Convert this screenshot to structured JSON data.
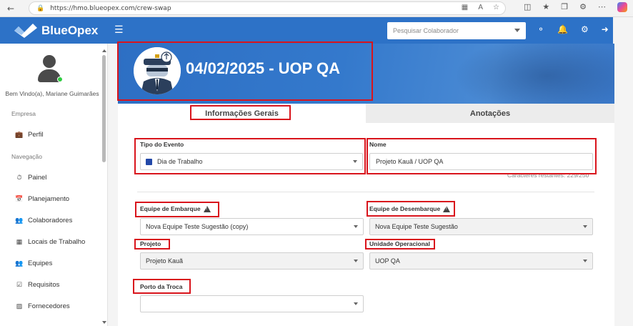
{
  "browser": {
    "url": "https://hmo.blueopex.com/crew-swap"
  },
  "header": {
    "brand": "BlueOpex",
    "search_placeholder": "Pesquisar Colaborador",
    "icons": [
      "support-icon",
      "bell-icon",
      "gear-icon",
      "logout-icon"
    ]
  },
  "sidebar": {
    "welcome": "Bem Vindo(a), Mariane Guimarães",
    "section_company": "Empresa",
    "section_nav": "Navegação",
    "items": [
      {
        "label": "Perfil",
        "icon": "briefcase-icon"
      },
      {
        "label": "Painel",
        "icon": "dashboard-icon"
      },
      {
        "label": "Planejamento",
        "icon": "calendar-icon"
      },
      {
        "label": "Colaboradores",
        "icon": "users-icon"
      },
      {
        "label": "Locais de Trabalho",
        "icon": "building-icon"
      },
      {
        "label": "Equipes",
        "icon": "team-icon"
      },
      {
        "label": "Requisitos",
        "icon": "checkbox-icon"
      },
      {
        "label": "Fornecedores",
        "icon": "truck-icon"
      }
    ]
  },
  "banner": {
    "title": "04/02/2025 - UOP QA"
  },
  "tabs": [
    {
      "label": "Informações Gerais",
      "active": true
    },
    {
      "label": "Anotações",
      "active": false
    }
  ],
  "form": {
    "tipo_evento": {
      "label": "Tipo do Evento",
      "value": "Dia de Trabalho",
      "color": "#2248a8"
    },
    "nome": {
      "label": "Nome",
      "value": "Projeto Kauã / UOP QA",
      "chars": "Caracteres restantes: 229/250"
    },
    "equipe_embarque": {
      "label": "Equipe de Embarque",
      "value": "Nova Equipe Teste Sugestão (copy)"
    },
    "equipe_desembarque": {
      "label": "Equipe de Desembarque",
      "value": "Nova Equipe Teste Sugestão"
    },
    "projeto": {
      "label": "Projeto",
      "value": "Projeto Kauã"
    },
    "unidade": {
      "label": "Unidade Operacional",
      "value": "UOP QA"
    },
    "porto": {
      "label": "Porto da Troca",
      "value": ""
    }
  },
  "colors": {
    "brand_blue": "#2d72c7",
    "highlight_red": "#d9141c"
  }
}
